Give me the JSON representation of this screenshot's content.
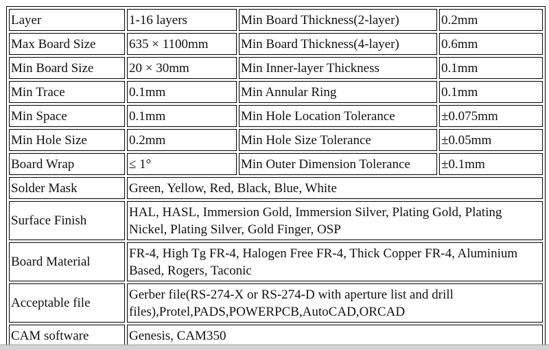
{
  "rows": [
    {
      "label": "Layer",
      "value": "1-16 layers",
      "label2": "Min Board Thickness(2-layer)",
      "value2": "0.2mm"
    },
    {
      "label": "Max Board Size",
      "value": "635 × 1100mm",
      "label2": "Min Board Thickness(4-layer)",
      "value2": "0.6mm"
    },
    {
      "label": "Min Board Size",
      "value": "20 × 30mm",
      "label2": "Min Inner-layer Thickness",
      "value2": "0.1mm"
    },
    {
      "label": "Min Trace",
      "value": "0.1mm",
      "label2": "Min Annular Ring",
      "value2": "0.1mm"
    },
    {
      "label": "Min Space",
      "value": "0.1mm",
      "label2": "Min Hole Location Tolerance",
      "value2": "±0.075mm"
    },
    {
      "label": "Min Hole Size",
      "value": "0.2mm",
      "label2": "Min Hole Size Tolerance",
      "value2": "±0.05mm"
    },
    {
      "label": "Board Wrap",
      "value": "≤ 1°",
      "label2": "Min Outer Dimension Tolerance",
      "value2": "±0.1mm"
    }
  ],
  "wide_rows": [
    {
      "label": "Solder Mask",
      "value": "Green, Yellow, Red, Black, Blue, White"
    },
    {
      "label": "Surface Finish",
      "value": "HAL, HASL, Immersion Gold, Immersion Silver, Plating Gold, Plating Nickel, Plating Silver, Gold Finger, OSP"
    },
    {
      "label": "Board Material",
      "value": "FR-4, High Tg FR-4, Halogen Free FR-4, Thick Copper FR-4, Aluminium Based, Rogers, Taconic"
    },
    {
      "label": "Acceptable file",
      "value": "Gerber file(RS-274-X or RS-274-D with aperture list and drill files),Protel,PADS,POWERPCB,AutoCAD,ORCAD"
    },
    {
      "label": "CAM software",
      "value": "Genesis, CAM350"
    }
  ]
}
